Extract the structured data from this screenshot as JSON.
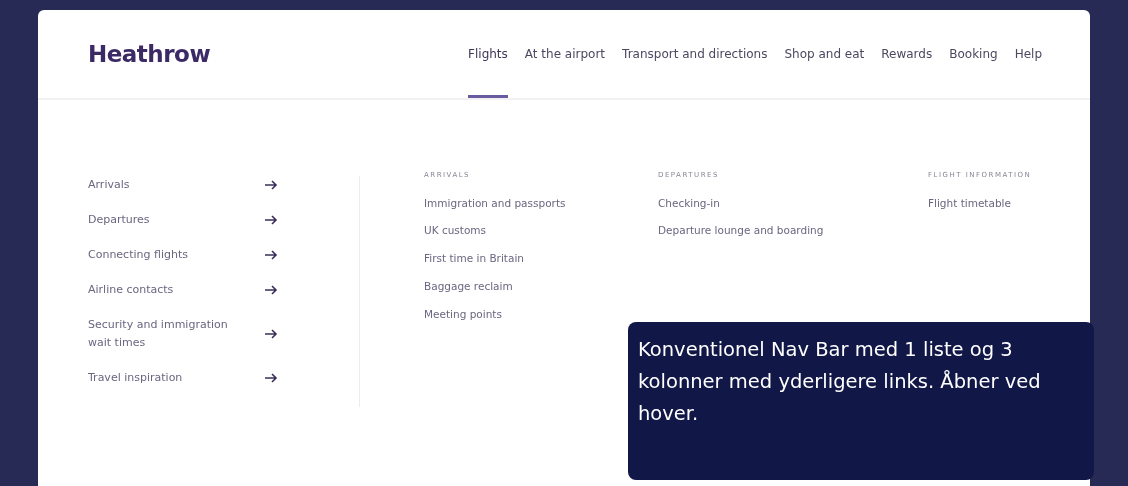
{
  "logo": "Heathrow",
  "nav": [
    {
      "label": "Flights",
      "selected": true
    },
    {
      "label": "At the airport",
      "selected": false
    },
    {
      "label": "Transport and directions",
      "selected": false
    },
    {
      "label": "Shop and eat",
      "selected": false
    },
    {
      "label": "Rewards",
      "selected": false
    },
    {
      "label": "Booking",
      "selected": false
    },
    {
      "label": "Help",
      "selected": false
    }
  ],
  "menu_list": [
    "Arrivals",
    "Departures",
    "Connecting flights",
    "Airline contacts",
    "Security and immigration wait times",
    "Travel inspiration"
  ],
  "columns": [
    {
      "heading": "ARRIVALS",
      "links": [
        "Immigration and passports",
        "UK customs",
        "First time in Britain",
        "Baggage reclaim",
        "Meeting points"
      ]
    },
    {
      "heading": "DEPARTURES",
      "links": [
        "Checking-in",
        "Departure lounge and boarding"
      ]
    },
    {
      "heading": "FLIGHT INFORMATION",
      "links": [
        "Flight timetable"
      ]
    }
  ],
  "annotation": "Konventionel Nav Bar med 1 liste og 3 kolonner med yderligere links. Åbner ved hover."
}
